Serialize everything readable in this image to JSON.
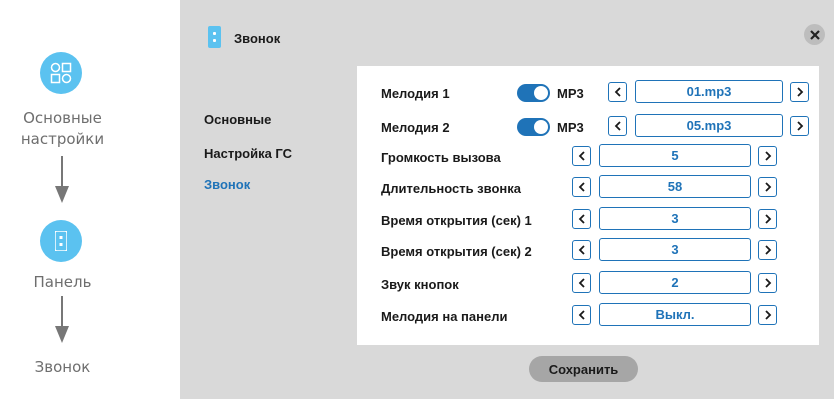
{
  "flow": {
    "step1_label": "Основные\nнастройки",
    "step2_label": "Панель",
    "step3_label": "Звонок"
  },
  "header": {
    "title": "Звонок"
  },
  "nav": {
    "items": [
      {
        "label": "Основные",
        "active": false
      },
      {
        "label": "Настройка ГС",
        "active": false
      },
      {
        "label": "Звонок",
        "active": true
      }
    ]
  },
  "settings": {
    "melody1": {
      "label": "Мелодия 1",
      "enabled": true,
      "format": "MP3",
      "value": "01.mp3"
    },
    "melody2": {
      "label": "Мелодия 2",
      "enabled": true,
      "format": "MP3",
      "value": "05.mp3"
    },
    "rows": [
      {
        "label": "Громкость вызова",
        "value": "5"
      },
      {
        "label": "Длительность звонка",
        "value": "58"
      },
      {
        "label": "Время открытия (сек) 1",
        "value": "3"
      },
      {
        "label": "Время открытия (сек) 2",
        "value": "3"
      },
      {
        "label": "Звук кнопок",
        "value": "2"
      },
      {
        "label": "Мелодия на панели",
        "value": "Выкл."
      }
    ]
  },
  "save_label": "Сохранить",
  "colors": {
    "accent": "#1f73b8",
    "icon_blue": "#5bc2f0",
    "panel_gray": "#d9d9d9",
    "button_gray": "#a6a6a6"
  }
}
